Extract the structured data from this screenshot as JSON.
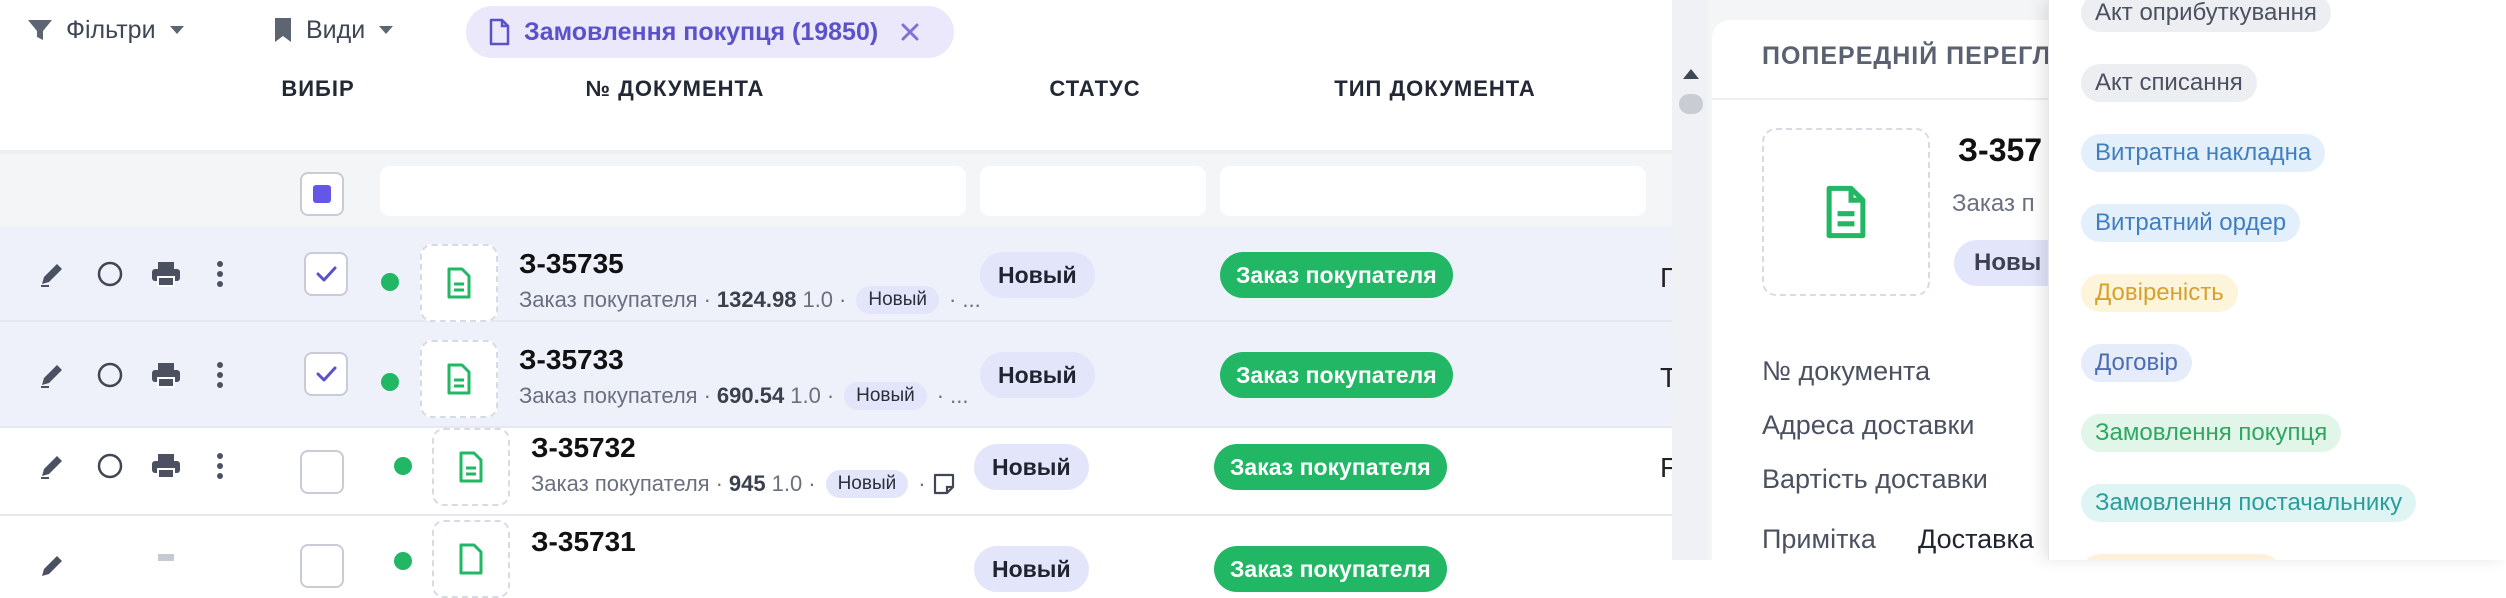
{
  "toolbar": {
    "filters_label": "Фільтри",
    "views_label": "Види",
    "active_filter": "Замовлення покупця (19850)"
  },
  "table": {
    "headers": {
      "select": "ВИБІР",
      "doc_number": "№ ДОКУМЕНТА",
      "status": "СТАТУС",
      "doc_type": "ТИП ДОКУМЕНТА"
    },
    "rows": [
      {
        "number": "З-35735",
        "kind": "Заказ покупателя",
        "amount": "1324.98",
        "qty": "1.0",
        "badge": "Новый",
        "tail": "...",
        "status": "Новый",
        "type": "Заказ покупателя",
        "extra": "Г",
        "selected": true
      },
      {
        "number": "З-35733",
        "kind": "Заказ покупателя",
        "amount": "690.54",
        "qty": "1.0",
        "badge": "Новый",
        "tail": "...",
        "status": "Новый",
        "type": "Заказ покупателя",
        "extra": "Т",
        "selected": true
      },
      {
        "number": "З-35732",
        "kind": "Заказ покупателя",
        "amount": "945",
        "qty": "1.0",
        "badge": "Новый",
        "tail": "",
        "status": "Новый",
        "type": "Заказ покупателя",
        "extra": "F",
        "selected": false
      },
      {
        "number": "З-35731",
        "kind": "",
        "amount": "",
        "qty": "",
        "badge": "",
        "tail": "",
        "status": "Новый",
        "type": "Заказ покупателя",
        "extra": "",
        "selected": false
      }
    ]
  },
  "preview": {
    "title": "ПОПЕРЕДНІЙ ПЕРЕГЛЯД",
    "doc_number": "З-357",
    "subtitle": "Заказ п",
    "badge": "Новы",
    "fields": [
      "№ документа",
      "Адреса доставки",
      "Вартість доставки",
      "Примітка"
    ],
    "note_value": "Доставка"
  },
  "doc_type_menu": [
    {
      "label": "Акт оприбуткування",
      "bg": "#eceef1",
      "fg": "#4b5160"
    },
    {
      "label": "Акт списання",
      "bg": "#eceef1",
      "fg": "#4b5160"
    },
    {
      "label": "Витратна накладна",
      "bg": "#e3f0fb",
      "fg": "#3f7fc0"
    },
    {
      "label": "Витратний ордер",
      "bg": "#e3f0fb",
      "fg": "#3f7fc0"
    },
    {
      "label": "Довіреність",
      "bg": "#fdf4dc",
      "fg": "#d7a22a"
    },
    {
      "label": "Договір",
      "bg": "#e6ecf9",
      "fg": "#4c6cb3"
    },
    {
      "label": "Замовлення покупця",
      "bg": "#e1f6e9",
      "fg": "#2fa662"
    },
    {
      "label": "Замовлення постачальнику",
      "bg": "#dff5f4",
      "fg": "#2a9d9a"
    }
  ],
  "colors": {
    "accent": "#6457e6",
    "green": "#22b765",
    "badge_bg": "#e3e5fb"
  }
}
